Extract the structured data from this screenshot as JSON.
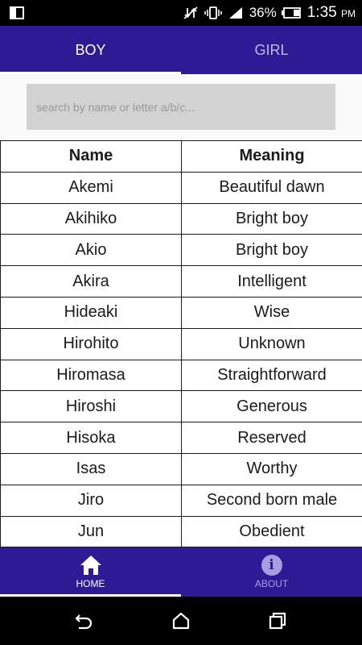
{
  "status_bar": {
    "battery": "36%",
    "time": "1:35",
    "ampm": "PM"
  },
  "tabs": [
    {
      "label": "BOY",
      "active": true
    },
    {
      "label": "GIRL",
      "active": false
    }
  ],
  "search": {
    "placeholder": "search by name or letter a/b/c...",
    "value": ""
  },
  "table": {
    "headers": [
      "Name",
      "Meaning"
    ],
    "rows": [
      [
        "Akemi",
        "Beautiful dawn"
      ],
      [
        "Akihiko",
        "Bright boy"
      ],
      [
        "Akio",
        "Bright boy"
      ],
      [
        "Akira",
        "Intelligent"
      ],
      [
        "Hideaki",
        "Wise"
      ],
      [
        "Hirohito",
        "Unknown"
      ],
      [
        "Hiromasa",
        "Straightforward"
      ],
      [
        "Hiroshi",
        "Generous"
      ],
      [
        "Hisoka",
        "Reserved"
      ],
      [
        "Isas",
        "Worthy"
      ],
      [
        "Jiro",
        "Second born male"
      ],
      [
        "Jun",
        "Obedient"
      ]
    ]
  },
  "bottom_nav": [
    {
      "label": "HOME",
      "icon": "home-icon",
      "active": true
    },
    {
      "label": "ABOUT",
      "icon": "info-icon",
      "active": false
    }
  ],
  "colors": {
    "primary": "#2e1a94",
    "inactive_tab": "#c3b9ec",
    "inactive_nav": "#a79ee0",
    "search_bg": "#d2d2d2"
  }
}
